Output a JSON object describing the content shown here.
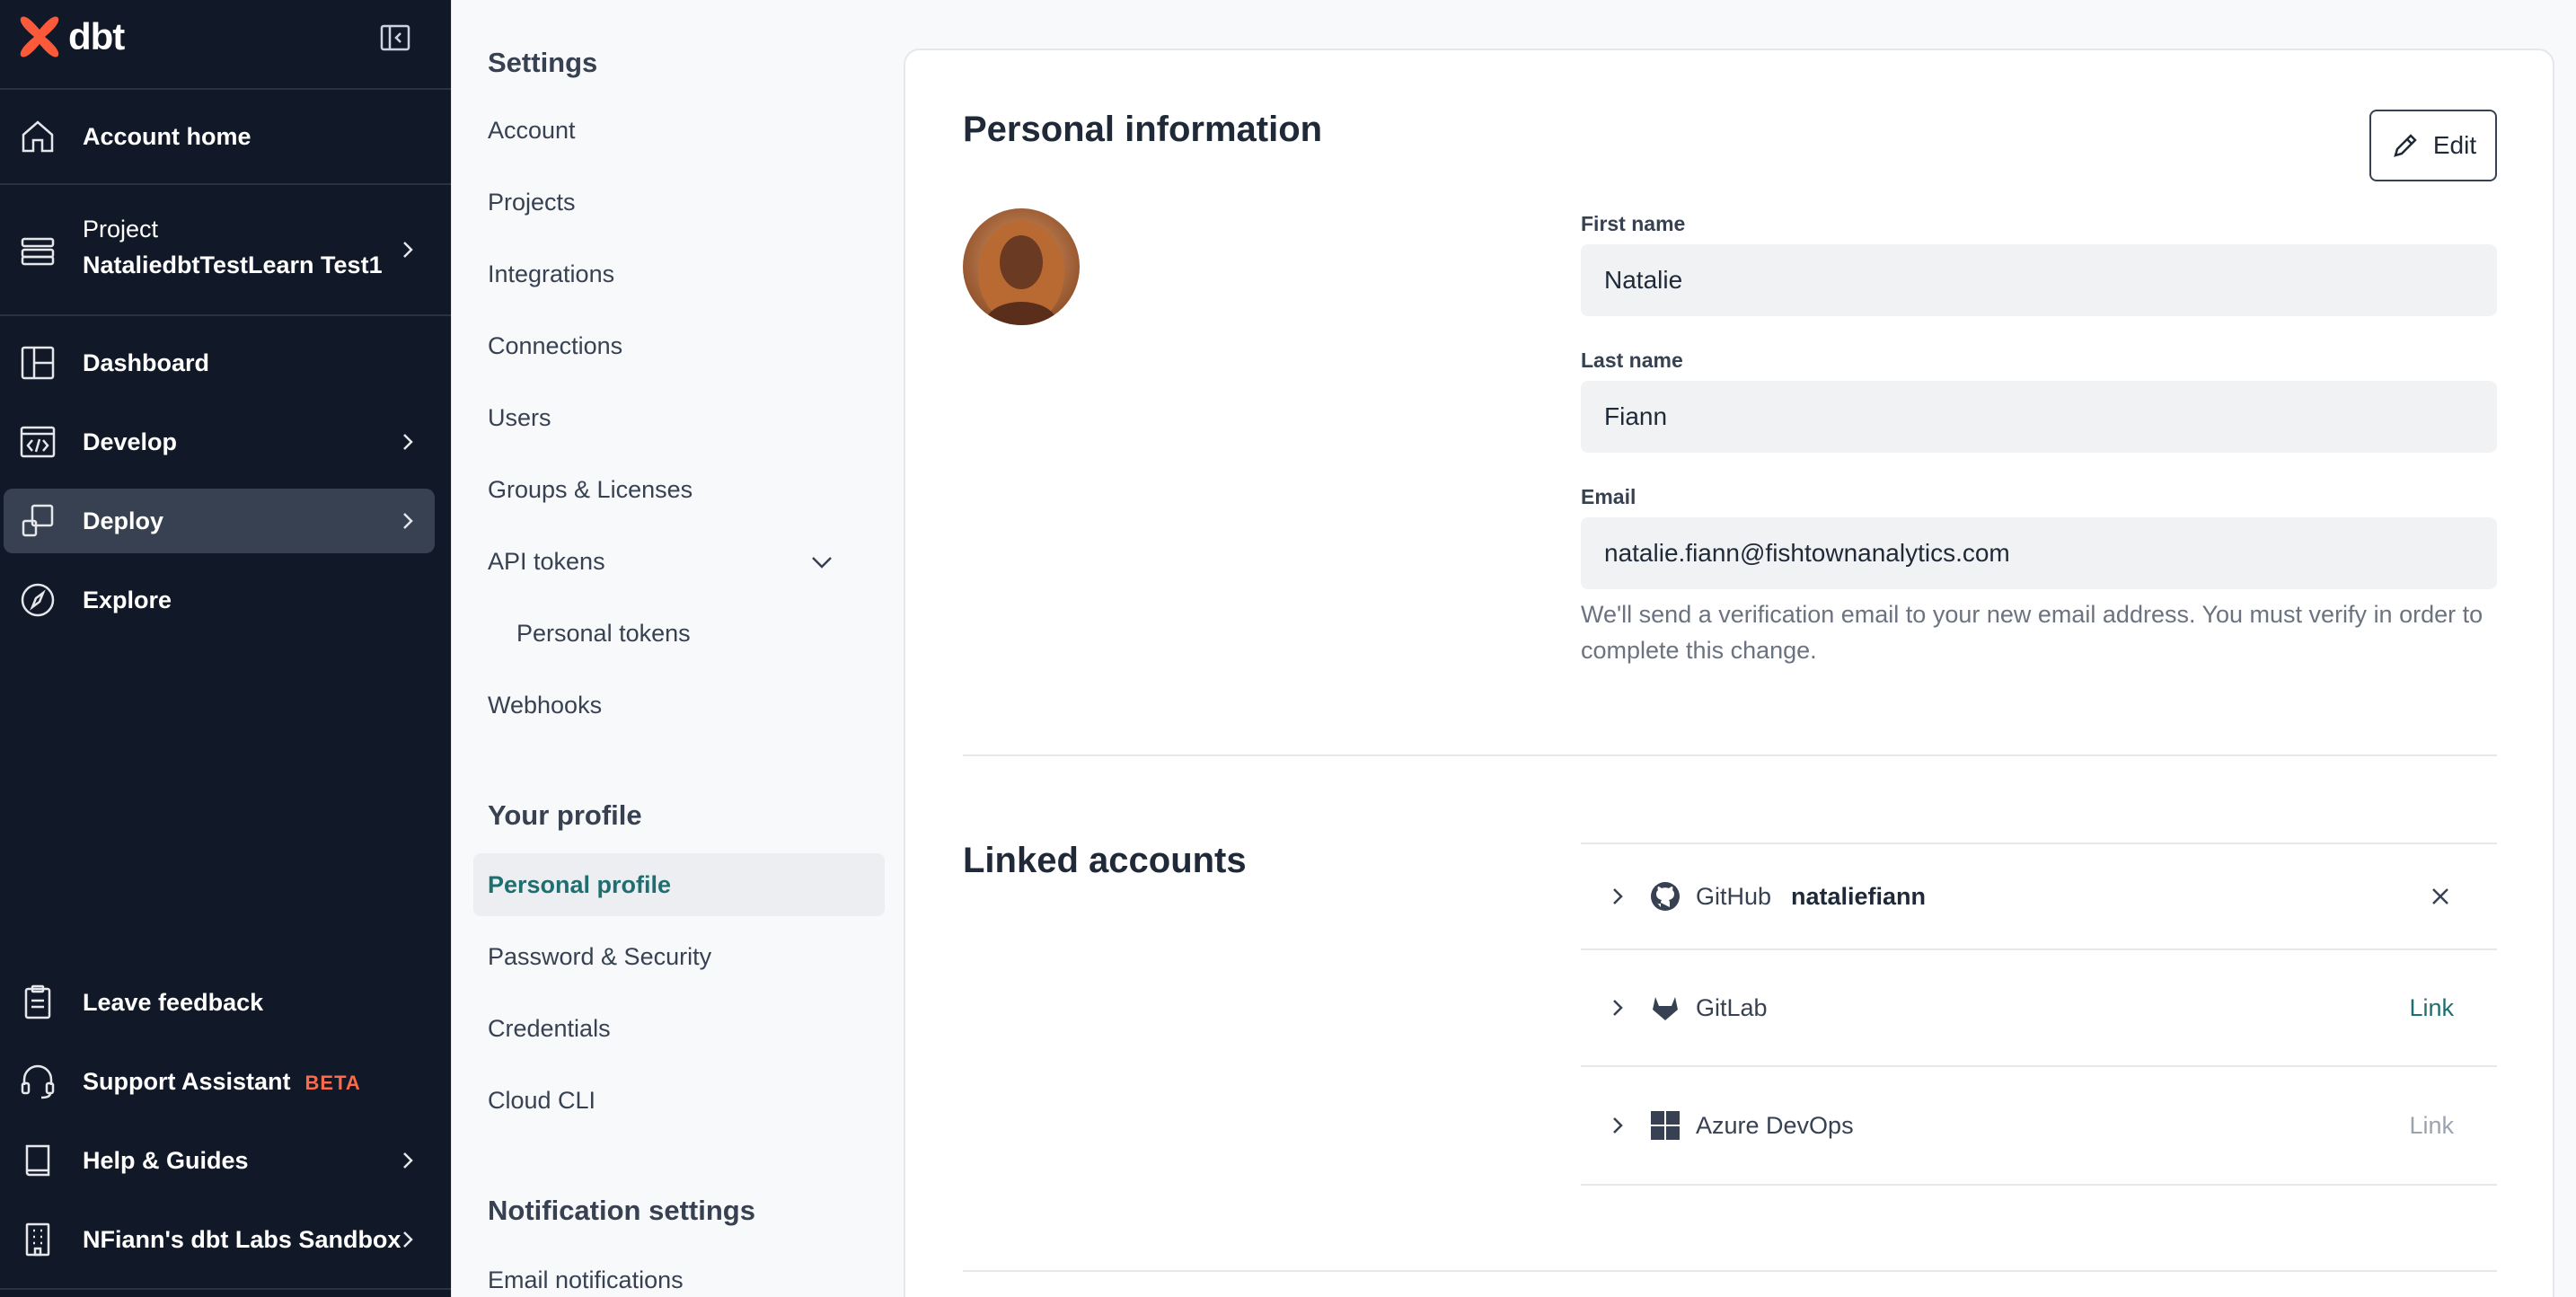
{
  "brand": {
    "name": "dbt",
    "accent": "#fb5a3a"
  },
  "nav": {
    "account_home": "Account home",
    "project_label": "Project",
    "project_name": "NataliedbtTestLearn Test1",
    "items": [
      {
        "label": "Dashboard",
        "icon": "dashboard-icon"
      },
      {
        "label": "Develop",
        "icon": "code-icon"
      },
      {
        "label": "Deploy",
        "icon": "deploy-icon"
      },
      {
        "label": "Explore",
        "icon": "compass-icon"
      }
    ],
    "bottom": [
      {
        "label": "Leave feedback",
        "icon": "clipboard-icon"
      },
      {
        "label": "Support Assistant",
        "icon": "headset-icon",
        "badge": "BETA"
      },
      {
        "label": "Help & Guides",
        "icon": "book-icon"
      },
      {
        "label": "NFiann's dbt Labs Sandbox",
        "icon": "building-icon"
      }
    ]
  },
  "settings": {
    "heading": "Settings",
    "items": [
      "Account",
      "Projects",
      "Integrations",
      "Connections",
      "Users",
      "Groups & Licenses",
      "API tokens",
      "Personal tokens",
      "Webhooks"
    ],
    "profile_heading": "Your profile",
    "profile_items": [
      "Personal profile",
      "Password & Security",
      "Credentials",
      "Cloud CLI"
    ],
    "notif_heading": "Notification settings",
    "notif_items": [
      "Email notifications"
    ]
  },
  "personal": {
    "title": "Personal information",
    "edit_label": "Edit",
    "first_name_label": "First name",
    "first_name": "Natalie",
    "last_name_label": "Last name",
    "last_name": "Fiann",
    "email_label": "Email",
    "email": "natalie.fiann@fishtownanalytics.com",
    "email_help": "We'll send a verification email to your new email address. You must verify in order to complete this change."
  },
  "linked": {
    "title": "Linked accounts",
    "rows": [
      {
        "provider": "GitHub",
        "username": "nataliefiann",
        "icon": "github-icon"
      },
      {
        "provider": "GitLab",
        "action": "Link",
        "icon": "gitlab-icon"
      },
      {
        "provider": "Azure DevOps",
        "action": "Link",
        "icon": "azure-devops-icon"
      }
    ]
  }
}
